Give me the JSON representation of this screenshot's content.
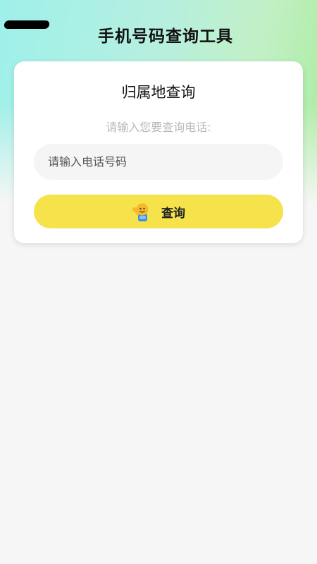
{
  "header": {
    "title": "手机号码查询工具"
  },
  "card": {
    "title": "归属地查询",
    "subtitle": "请输入您要查询电话:",
    "input": {
      "placeholder": "请输入电话号码",
      "value": ""
    },
    "button": {
      "label": "查询",
      "icon": "emoji-person-icon"
    }
  },
  "colors": {
    "accent_button": "#f6e24a",
    "gradient_left": "#9ef0ea",
    "gradient_right": "#a9ec9e",
    "background": "#f6f6f6"
  }
}
